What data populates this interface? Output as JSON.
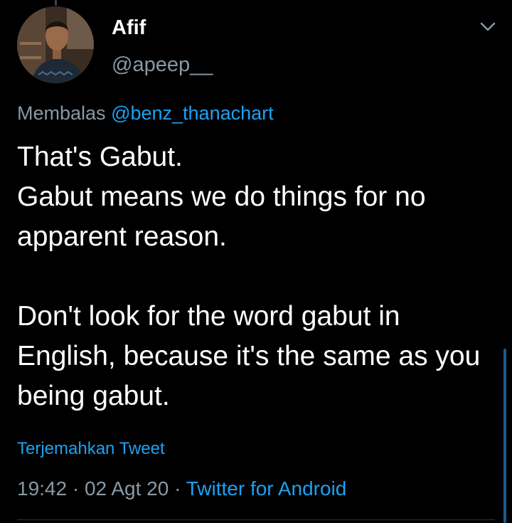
{
  "author": {
    "display_name": "Afif",
    "handle": "@apeep__",
    "avatar_icon": "profile-photo"
  },
  "reply": {
    "prefix": "Membalas",
    "mention": "@benz_thanachart"
  },
  "tweet": {
    "paragraph_1": "That's Gabut.\nGabut means we do things for no apparent reason.",
    "paragraph_2": "Don't look for the word gabut in English, because it's the same as you being gabut."
  },
  "translate_label": "Terjemahkan Tweet",
  "meta": {
    "time": "19:42",
    "separator": " · ",
    "date": "02 Agt 20",
    "source": "Twitter for Android"
  },
  "icons": {
    "menu": "chevron-down-icon"
  },
  "colors": {
    "background": "#000000",
    "text_primary": "#ffffff",
    "text_secondary": "#8899a6",
    "accent": "#1da1f2"
  }
}
